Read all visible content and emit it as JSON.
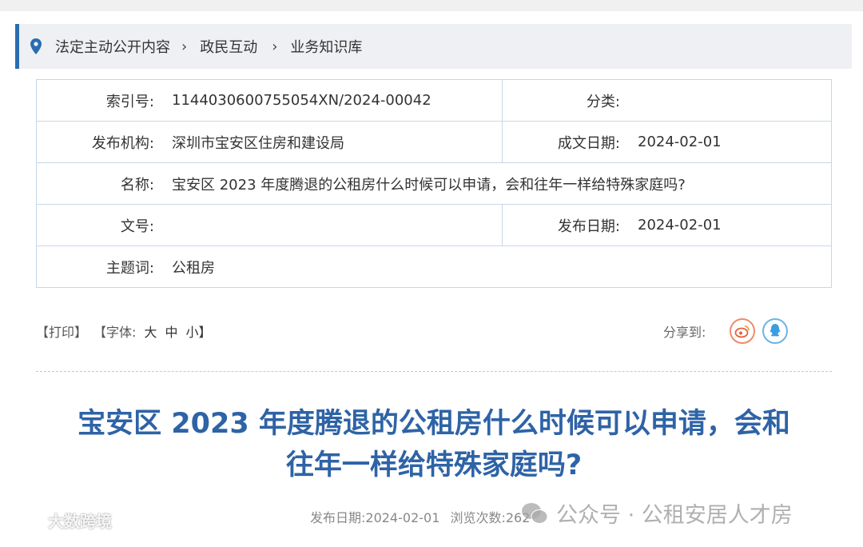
{
  "breadcrumb": {
    "items": [
      "法定主动公开内容",
      "政民互动",
      "业务知识库"
    ],
    "separator": "›"
  },
  "meta": {
    "index_label": "索引号:",
    "index_value": "1144030600755054XN/2024-00042",
    "category_label": "分类:",
    "category_value": "",
    "publisher_label": "发布机构:",
    "publisher_value": "深圳市宝安区住房和建设局",
    "created_label": "成文日期:",
    "created_value": "2024-02-01",
    "name_label": "名称:",
    "name_value": "宝安区 2023 年度腾退的公租房什么时候可以申请，会和往年一样给特殊家庭吗?",
    "docno_label": "文号:",
    "docno_value": "",
    "published_label": "发布日期:",
    "published_value": "2024-02-01",
    "keywords_label": "主题词:",
    "keywords_value": "公租房"
  },
  "toolbar": {
    "print": "【打印】",
    "font_label": "【字体:",
    "font_large": "大",
    "font_medium": "中",
    "font_small": "小】",
    "share_label": "分享到:"
  },
  "article": {
    "title_line1": "宝安区 2023 年度腾退的公租房什么时候可以申请，会和",
    "title_line2": "往年一样给特殊家庭吗?",
    "pub_date": "发布日期:2024-02-01",
    "views": "浏览次数:262"
  },
  "overlays": {
    "wechat_watermark": "公众号 · 公租安居人才房",
    "corner_watermark": "大数跨境"
  },
  "icons": {
    "location": "location-pin-icon",
    "weibo": "weibo-icon",
    "qq": "qq-icon"
  },
  "colors": {
    "accent": "#2a6cb0",
    "title": "#2e63a6",
    "table_border": "#c7d7e6"
  }
}
